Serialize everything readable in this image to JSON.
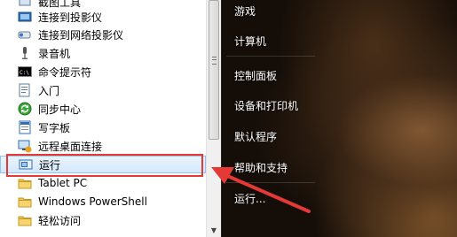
{
  "program_list": {
    "items": [
      {
        "label": "截图工具",
        "icon": "scissors-icon"
      },
      {
        "label": "连接到投影仪",
        "icon": "projector-icon"
      },
      {
        "label": "连接到网络投影仪",
        "icon": "network-projector-icon"
      },
      {
        "label": "录音机",
        "icon": "microphone-icon"
      },
      {
        "label": "命令提示符",
        "icon": "cmd-icon"
      },
      {
        "label": "入门",
        "icon": "getting-started-icon"
      },
      {
        "label": "同步中心",
        "icon": "sync-icon"
      },
      {
        "label": "写字板",
        "icon": "wordpad-icon"
      },
      {
        "label": "远程桌面连接",
        "icon": "remote-desktop-icon"
      },
      {
        "label": "运行",
        "icon": "run-icon"
      },
      {
        "label": "Tablet PC",
        "icon": "folder-icon"
      },
      {
        "label": "Windows PowerShell",
        "icon": "folder-icon"
      },
      {
        "label": "轻松访问",
        "icon": "folder-icon"
      }
    ],
    "selected_index": 9
  },
  "start_menu_right": {
    "links": [
      "游戏",
      "计算机",
      "控制面板",
      "设备和打印机",
      "默认程序",
      "帮助和支持",
      "运行..."
    ]
  },
  "colors": {
    "highlight_border": "#e53935",
    "selection_bg": "#d4e8fb",
    "arrow": "#e53935"
  }
}
